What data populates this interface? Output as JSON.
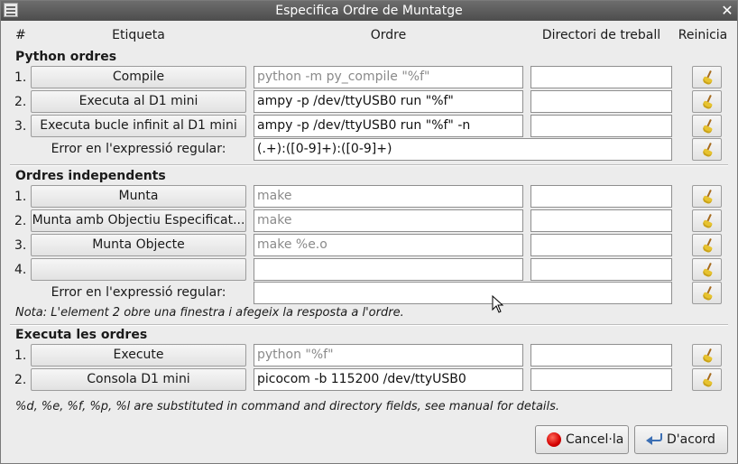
{
  "window": {
    "title": "Especifica Ordre de Muntatge"
  },
  "headers": {
    "num": "#",
    "label": "Etiqueta",
    "command": "Ordre",
    "workdir": "Directori de treball",
    "reset": "Reinicia"
  },
  "python": {
    "title": "Python ordres",
    "rows": [
      {
        "num": "1.",
        "label": "Compile",
        "command": "python -m py_compile \"%f\"",
        "command_placeholder": true,
        "dir": ""
      },
      {
        "num": "2.",
        "label": "Executa al D1 mini",
        "command": "ampy -p /dev/ttyUSB0 run \"%f\"",
        "command_placeholder": false,
        "dir": ""
      },
      {
        "num": "3.",
        "label": "Executa bucle infinit al D1 mini",
        "command": "ampy -p /dev/ttyUSB0 run \"%f\" -n",
        "command_placeholder": false,
        "dir": ""
      }
    ],
    "regex_label": "Error en l'expressió regular:",
    "regex_value": "(.+):([0-9]+):([0-9]+)"
  },
  "independent": {
    "title": "Ordres independents",
    "rows": [
      {
        "num": "1.",
        "label": "Munta",
        "command": "make",
        "command_placeholder": true,
        "dir": ""
      },
      {
        "num": "2.",
        "label": "Munta amb Objectiu Especificat...",
        "command": "make",
        "command_placeholder": true,
        "dir": ""
      },
      {
        "num": "3.",
        "label": "Munta Objecte",
        "command": "make %e.o",
        "command_placeholder": true,
        "dir": ""
      },
      {
        "num": "4.",
        "label": "",
        "command": "",
        "command_placeholder": false,
        "dir": ""
      }
    ],
    "regex_label": "Error en l'expressió regular:",
    "regex_value": "",
    "note": "Nota: L'element 2 obre una finestra i afegeix la resposta a l'ordre."
  },
  "execute": {
    "title": "Executa les ordres",
    "rows": [
      {
        "num": "1.",
        "label": "Execute",
        "command": "python \"%f\"",
        "command_placeholder": true,
        "dir": ""
      },
      {
        "num": "2.",
        "label": "Consola D1 mini",
        "command": "picocom -b 115200 /dev/ttyUSB0",
        "command_placeholder": false,
        "dir": ""
      }
    ]
  },
  "footer_note": "%d, %e, %f, %p, %l are substituted in command and directory fields, see manual for details.",
  "buttons": {
    "cancel": "Cancel·la",
    "ok": "D'acord"
  },
  "icons": {
    "reset": "broom-icon",
    "cancel": "stop-icon",
    "ok": "ok-arrow-icon"
  }
}
